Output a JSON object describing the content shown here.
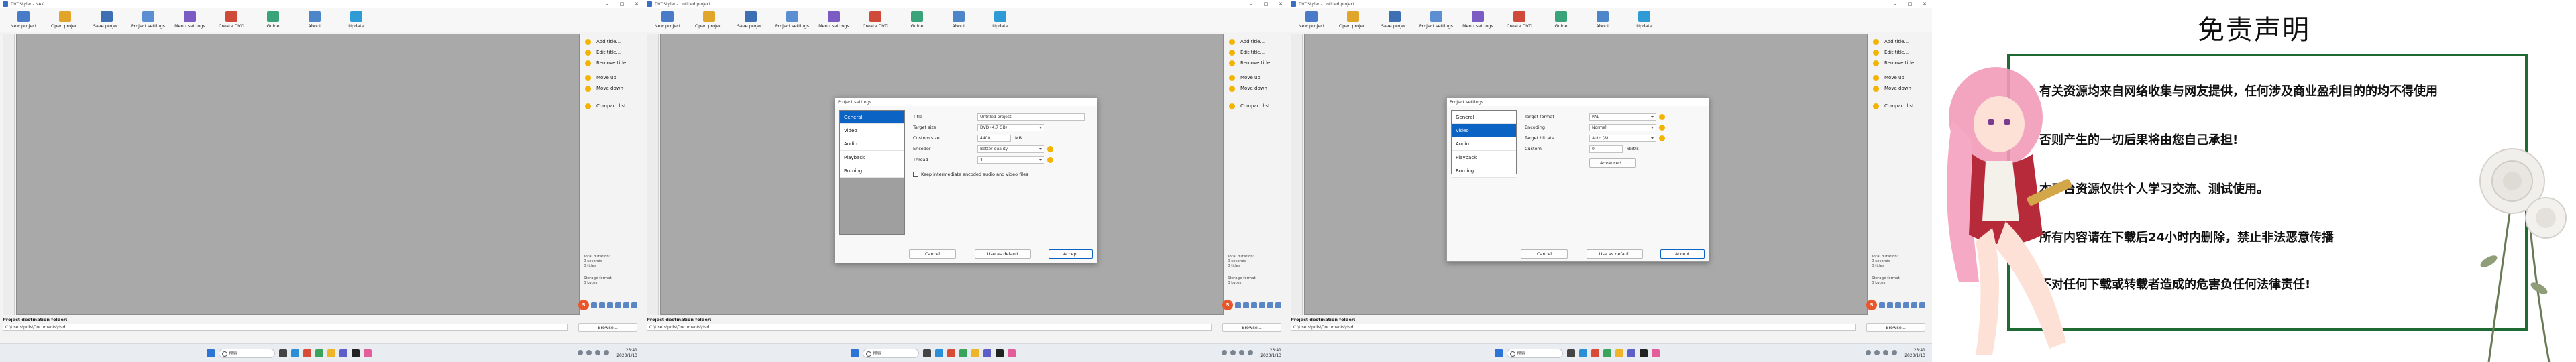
{
  "apps": [
    {
      "id": "app1",
      "window_title": "DVDStyler - NAK",
      "toolbar": [
        "New project",
        "Open project",
        "Save project",
        "Project settings",
        "Menu settings",
        "Create DVD",
        "Guide",
        "About",
        "Update"
      ],
      "sidebar": [
        "Add title...",
        "Edit title...",
        "Remove title",
        "Move up",
        "Move down",
        "Compact list"
      ],
      "stats": "Total duration:\n0 seconds\n0 titles",
      "stats2": "Storage format:\n0 bytes",
      "destination_label": "Project destination folder:",
      "destination_path": "C:\\Users\\pdfs\\Documents\\dvd",
      "browse": "Browse...",
      "search_placeholder": "搜索",
      "clock": "23:41\n2023/1/13"
    },
    {
      "id": "app2",
      "window_title": "DVDStyler - Untitled project",
      "toolbar": [
        "New project",
        "Open project",
        "Save project",
        "Project settings",
        "Menu settings",
        "Create DVD",
        "Guide",
        "About",
        "Update"
      ],
      "sidebar": [
        "Add title...",
        "Edit title...",
        "Remove title",
        "Move up",
        "Move down",
        "Compact list"
      ],
      "stats": "Total duration:\n0 seconds\n0 titles",
      "stats2": "Storage format:\n0 bytes",
      "destination_label": "Project destination folder:",
      "destination_path": "C:\\Users\\pdfs\\Documents\\dvd",
      "browse": "Browse...",
      "search_placeholder": "搜索",
      "clock": "23:41\n2023/1/13",
      "dialog": {
        "title": "Project settings",
        "nav": [
          "General",
          "Video",
          "Audio",
          "Playback",
          "Burning"
        ],
        "active_nav": 0,
        "fields": [
          {
            "label": "Title",
            "value": "Untitled project",
            "select": false,
            "help": false
          },
          {
            "label": "Target size",
            "value": "DVD (4.7 GB)",
            "select": true,
            "help": false
          },
          {
            "label": "Custom size",
            "value": "4400",
            "select": false,
            "help": false,
            "unit": "MB"
          },
          {
            "label": "Encoder",
            "value": "Better quality",
            "select": true,
            "help": true
          },
          {
            "label": "Thread",
            "value": "4",
            "select": true,
            "help": true
          }
        ],
        "checkbox": "Keep intermediate encoded audio and video files",
        "buttons": [
          "Cancel",
          "Use as default",
          "Accept"
        ]
      }
    },
    {
      "id": "app3",
      "window_title": "DVDStyler - Untitled project",
      "toolbar": [
        "New project",
        "Open project",
        "Save project",
        "Project settings",
        "Menu settings",
        "Create DVD",
        "Guide",
        "About",
        "Update"
      ],
      "sidebar": [
        "Add title...",
        "Edit title...",
        "Remove title",
        "Move up",
        "Move down",
        "Compact list"
      ],
      "stats": "Total duration:\n0 seconds\n0 titles",
      "stats2": "Storage format:\n0 bytes",
      "destination_label": "Project destination folder:",
      "destination_path": "C:\\Users\\pdfs\\Documents\\dvd",
      "browse": "Browse...",
      "search_placeholder": "搜索",
      "clock": "23:41\n2023/1/13",
      "dialog": {
        "title": "Project settings",
        "nav": [
          "General",
          "Video",
          "Audio",
          "Playback",
          "Burning"
        ],
        "active_nav": 1,
        "fields": [
          {
            "label": "Target format",
            "value": "PAL",
            "select": true,
            "help": true
          },
          {
            "label": "Encoding",
            "value": "Normal",
            "select": true,
            "help": true
          },
          {
            "label": "Target bitrate",
            "value": "Auto (8)",
            "select": true,
            "help": true
          },
          {
            "label": "Custom",
            "value": "0",
            "select": false,
            "help": false,
            "unit": "kbit/s"
          }
        ],
        "advanced": "Advanced...",
        "buttons": [
          "Cancel",
          "Use as default",
          "Accept"
        ]
      }
    }
  ],
  "disclaimer": {
    "title": "免责声明",
    "lines": [
      "有关资源均来自网络收集与网友提供，任何涉及商业盈利目的的均不得使用",
      "否则产生的一切后果将由您自己承担!",
      "本平台资源仅供个人学习交流、测试使用。",
      "所有内容请在下载后24小时内删除，禁止非法恶意传播",
      "不对任何下载或转载者造成的危害负任何法律责任!"
    ]
  },
  "colors": {
    "accent": "#0b63c4",
    "frame_green": "#1f6b34",
    "workarea_gray": "#a9a9a9",
    "help_yellow": "#f2b400"
  },
  "icons": {
    "toolbar": [
      "new-project-icon",
      "open-project-icon",
      "save-project-icon",
      "project-settings-icon",
      "menu-settings-icon",
      "create-dvd-icon",
      "guide-icon",
      "about-icon",
      "update-icon"
    ],
    "sidebar": [
      "add-title-icon",
      "edit-title-icon",
      "remove-title-icon",
      "move-up-icon",
      "move-down-icon",
      "compact-list-icon"
    ]
  }
}
